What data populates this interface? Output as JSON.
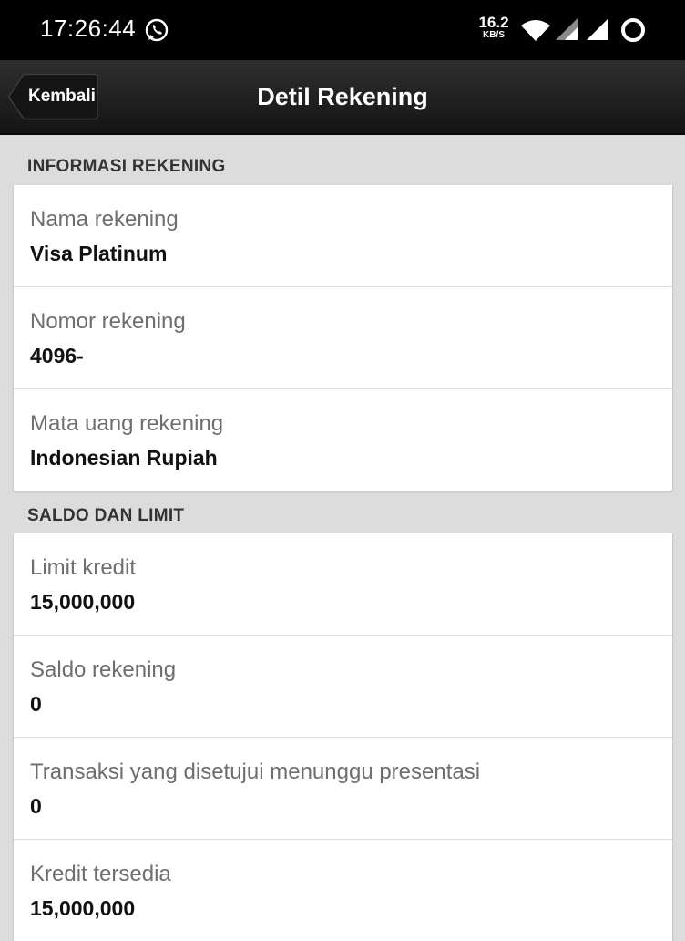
{
  "status_bar": {
    "time": "17:26:44",
    "net_speed_value": "16.2",
    "net_speed_unit": "KB/S"
  },
  "header": {
    "back_label": "Kembali",
    "title": "Detil Rekening"
  },
  "sections": [
    {
      "title": "INFORMASI REKENING",
      "rows": [
        {
          "label": "Nama rekening",
          "value": "Visa Platinum"
        },
        {
          "label": "Nomor rekening",
          "value": "4096-"
        },
        {
          "label": "Mata uang rekening",
          "value": "Indonesian Rupiah"
        }
      ]
    },
    {
      "title": "SALDO DAN LIMIT",
      "rows": [
        {
          "label": "Limit kredit",
          "value": "15,000,000"
        },
        {
          "label": "Saldo rekening",
          "value": "0"
        },
        {
          "label": "Transaksi yang disetujui menunggu presentasi",
          "value": "0"
        },
        {
          "label": "Kredit tersedia",
          "value": "15,000,000"
        }
      ]
    }
  ],
  "colors": {
    "status_bar_bg": "#000000",
    "header_bg": "#1e1e1e",
    "page_bg": "#dcdcdc",
    "card_bg": "#ffffff",
    "label_text": "#6e6e6e",
    "value_text": "#111111"
  },
  "icons": {
    "messaging": "whatsapp-icon",
    "wifi": "wifi-icon",
    "signal": "signal-icon",
    "sync": "sync-icon",
    "back": "back-arrow-button"
  }
}
